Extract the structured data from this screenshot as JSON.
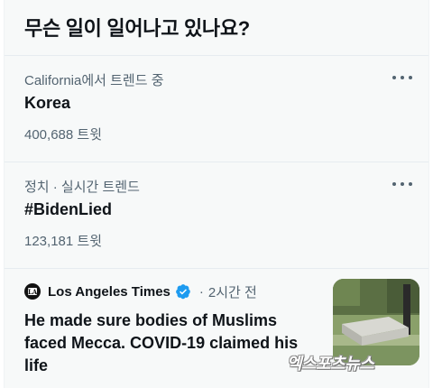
{
  "header": {
    "title": "무슨 일이 일어나고 있나요?"
  },
  "trends": [
    {
      "context": "California에서 트렌드 중",
      "name": "Korea",
      "count": "400,688 트윗",
      "more_icon": "more-horizontal-icon"
    },
    {
      "context": "정치 · 실시간 트렌드",
      "name": "#BidenLied",
      "count": "123,181 트윗",
      "more_icon": "more-horizontal-icon"
    }
  ],
  "news": {
    "source": "Los Angeles Times",
    "verified_icon": "verified-badge-icon",
    "separator": "·",
    "time": "2시간 전",
    "headline": "He made sure bodies of Muslims faced Mecca. COVID-19 claimed his life",
    "thumbnail": "cemetery-grave-image"
  },
  "watermark": "엑스포츠뉴스",
  "colors": {
    "primary_text": "#0f1419",
    "secondary_text": "#536471",
    "verified_blue": "#1d9bf0",
    "panel_bg": "#f7f9f9"
  }
}
